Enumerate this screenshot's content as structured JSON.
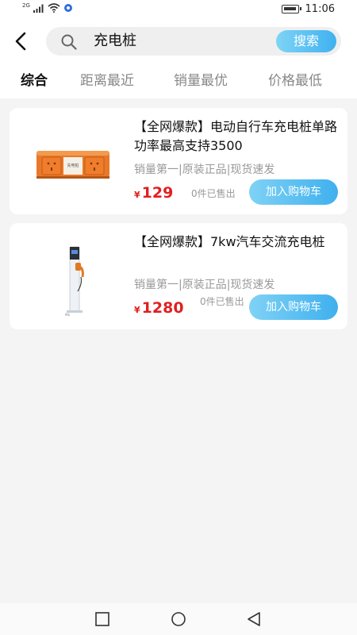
{
  "status_bar": {
    "network": "2G",
    "time": "11:06"
  },
  "search": {
    "query": "充电桩",
    "button_label": "搜索"
  },
  "tabs": [
    {
      "label": "综合",
      "active": true
    },
    {
      "label": "距离最近",
      "active": false
    },
    {
      "label": "销量最优",
      "active": false
    },
    {
      "label": "价格最低",
      "active": false
    }
  ],
  "products": [
    {
      "title": "【全网爆款】电动自行车充电桩单路功率最高支持3500",
      "tags": "销量第一|原装正品|现货速发",
      "currency": "¥",
      "price": "129",
      "sold": "0件已售出",
      "cart_label": "加入购物车",
      "image_icon": "orange-charging-socket-box",
      "image_label": "充电桩"
    },
    {
      "title": "【全网爆款】7kw汽车交流充电桩",
      "tags": "销量第一|原装正品|现货速发",
      "currency": "¥",
      "price": "1280",
      "sold": "0件已售出",
      "cart_label": "加入购物车",
      "image_icon": "ev-charging-pillar",
      "image_label": "Mb"
    }
  ],
  "nav": {
    "recent_icon": "square-icon",
    "home_icon": "circle-icon",
    "back_icon": "triangle-icon"
  },
  "colors": {
    "accent": "#3fb1f0",
    "price": "#e02020",
    "tag": "#999999"
  }
}
